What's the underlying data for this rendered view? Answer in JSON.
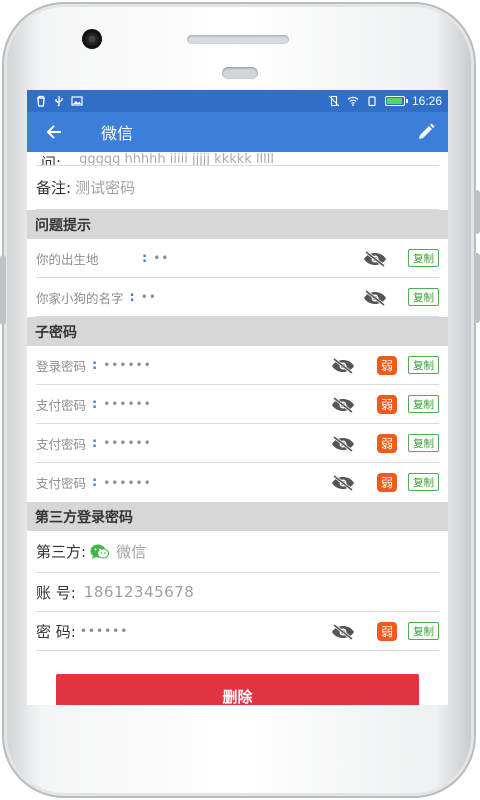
{
  "statusbar": {
    "time": "16:26"
  },
  "toolbar": {
    "title": "微信"
  },
  "partial_row": {
    "label": "问:",
    "value": "ggggg hhhhh iiiii jjjjj kkkkk lllll"
  },
  "note": {
    "label": "备注:",
    "value": "测试密码"
  },
  "security_questions": {
    "title": "问题提示",
    "items": [
      {
        "label": "你的出生地",
        "value": "••",
        "copy_label": "复制"
      },
      {
        "label": "你家小狗的名字",
        "value": "••",
        "copy_label": "复制"
      }
    ]
  },
  "sub_passwords": {
    "title": "子密码",
    "items": [
      {
        "label": "登录密码",
        "value": "••••••",
        "strength": "弱",
        "copy_label": "复制"
      },
      {
        "label": "支付密码",
        "value": "••••••",
        "strength": "弱",
        "copy_label": "复制"
      },
      {
        "label": "支付密码",
        "value": "••••••",
        "strength": "弱",
        "copy_label": "复制"
      },
      {
        "label": "支付密码",
        "value": "••••••",
        "strength": "弱",
        "copy_label": "复制"
      }
    ]
  },
  "third_party": {
    "title": "第三方登录密码",
    "provider_label": "第三方:",
    "provider_name": "微信",
    "account_label": "账 号:",
    "account_value": "18612345678",
    "password_label": "密 码:",
    "password_value": "••••••",
    "strength": "弱",
    "copy_label": "复制"
  },
  "delete_button": {
    "label": "删除"
  },
  "colors": {
    "statusbar": "#2f6fc7",
    "toolbar": "#3c7fd8",
    "section_bg": "#d7d7d7",
    "weak_badge": "#ef5a1e",
    "copy_border": "#4fae50",
    "delete": "#e13340",
    "wechat": "#44b549"
  }
}
